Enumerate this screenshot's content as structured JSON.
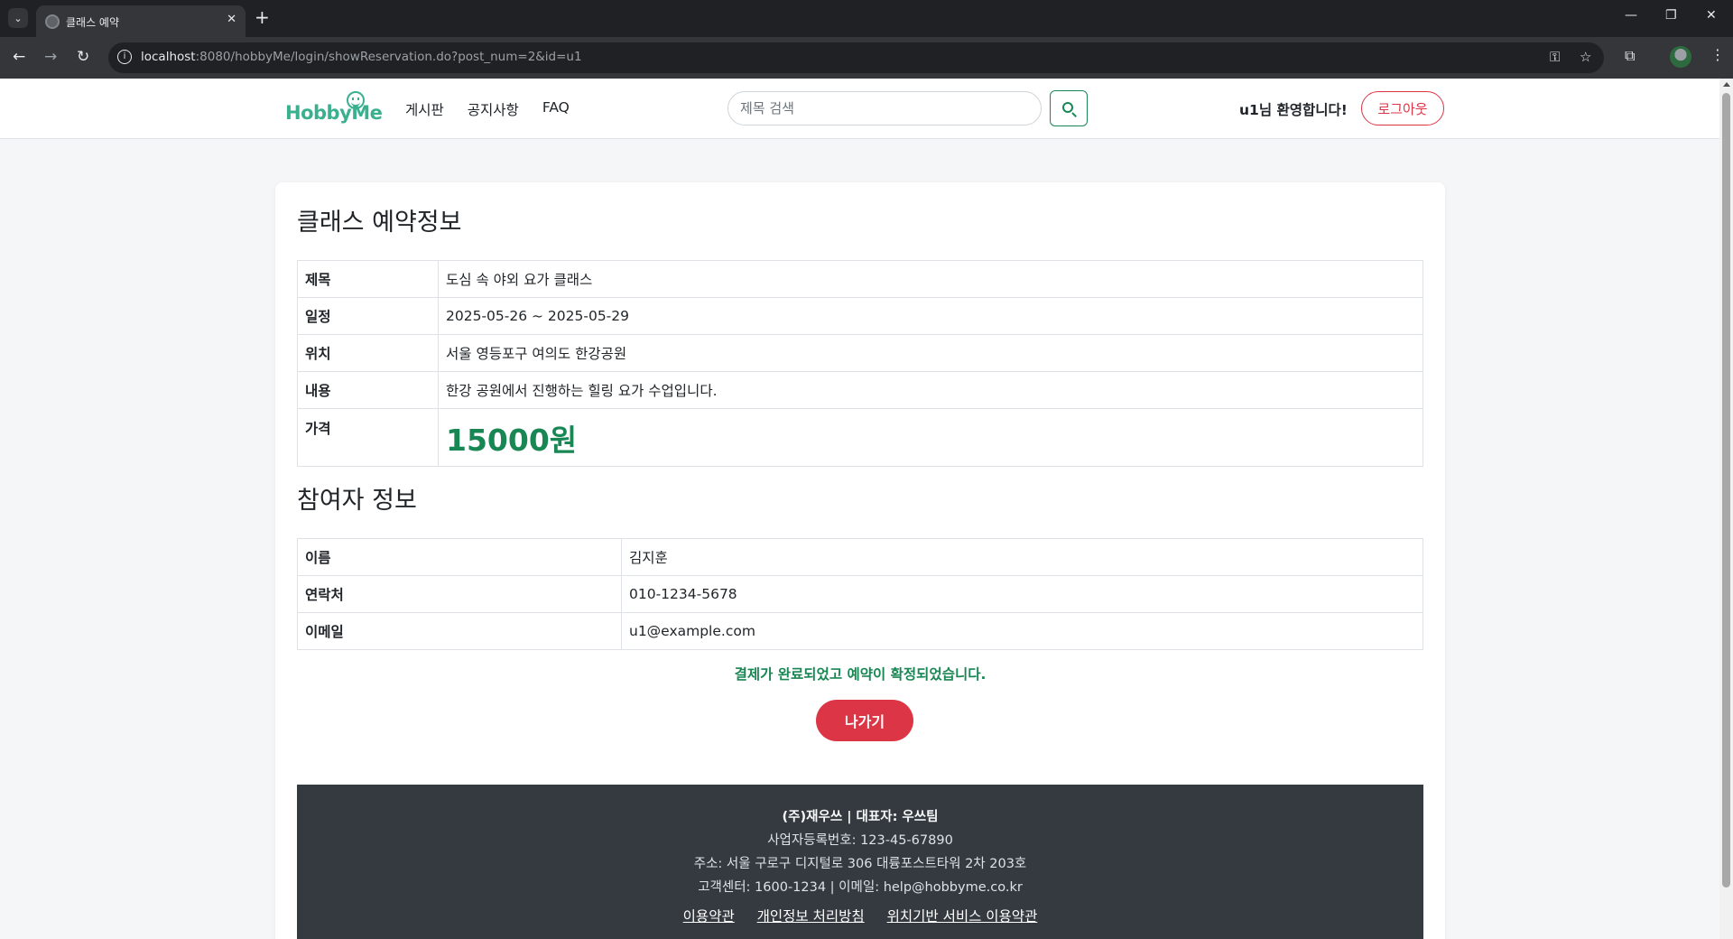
{
  "browser": {
    "tab_title": "클래스 예약",
    "url_host": "localhost",
    "url_rest": ":8080/hobbyMe/login/showReservation.do?post_num=2&id=u1"
  },
  "header": {
    "logo_text": "HobbyMe",
    "nav": [
      "게시판",
      "공지사항",
      "FAQ"
    ],
    "search_placeholder": "제목 검색",
    "welcome": "u1님 환영합니다!",
    "logout_label": "로그아웃"
  },
  "reservation": {
    "title": "클래스 예약정보",
    "rows": [
      {
        "label": "제목",
        "value": "도심 속 야외 요가 클래스"
      },
      {
        "label": "일정",
        "value": "2025-05-26 ~ 2025-05-29"
      },
      {
        "label": "위치",
        "value": "서울 영등포구 여의도 한강공원"
      },
      {
        "label": "내용",
        "value": "한강 공원에서 진행하는 힐링 요가 수업입니다."
      }
    ],
    "price_label": "가격",
    "price_value": "15000원"
  },
  "participant": {
    "title": "참여자 정보",
    "rows": [
      {
        "label": "이름",
        "value": "김지훈"
      },
      {
        "label": "연락처",
        "value": "010-1234-5678"
      },
      {
        "label": "이메일",
        "value": "u1@example.com"
      }
    ]
  },
  "confirmation_message": "결제가 완료되었고 예약이 확정되었습니다.",
  "exit_label": "나가기",
  "footer": {
    "company": "(주)재우쓰 | 대표자: 우쓰팀",
    "business_no": "사업자등록번호: 123-45-67890",
    "address": "주소: 서울 구로구 디지털로 306 대륭포스트타워 2차 203호",
    "contact": "고객센터: 1600-1234 | 이메일: help@hobbyme.co.kr",
    "links": [
      "이용약관",
      "개인정보 처리방침",
      "위치기반 서비스 이용약관"
    ]
  },
  "colors": {
    "brand": "#3bb08f",
    "success": "#198754",
    "danger": "#dc3545",
    "footer_bg": "#343a40"
  }
}
